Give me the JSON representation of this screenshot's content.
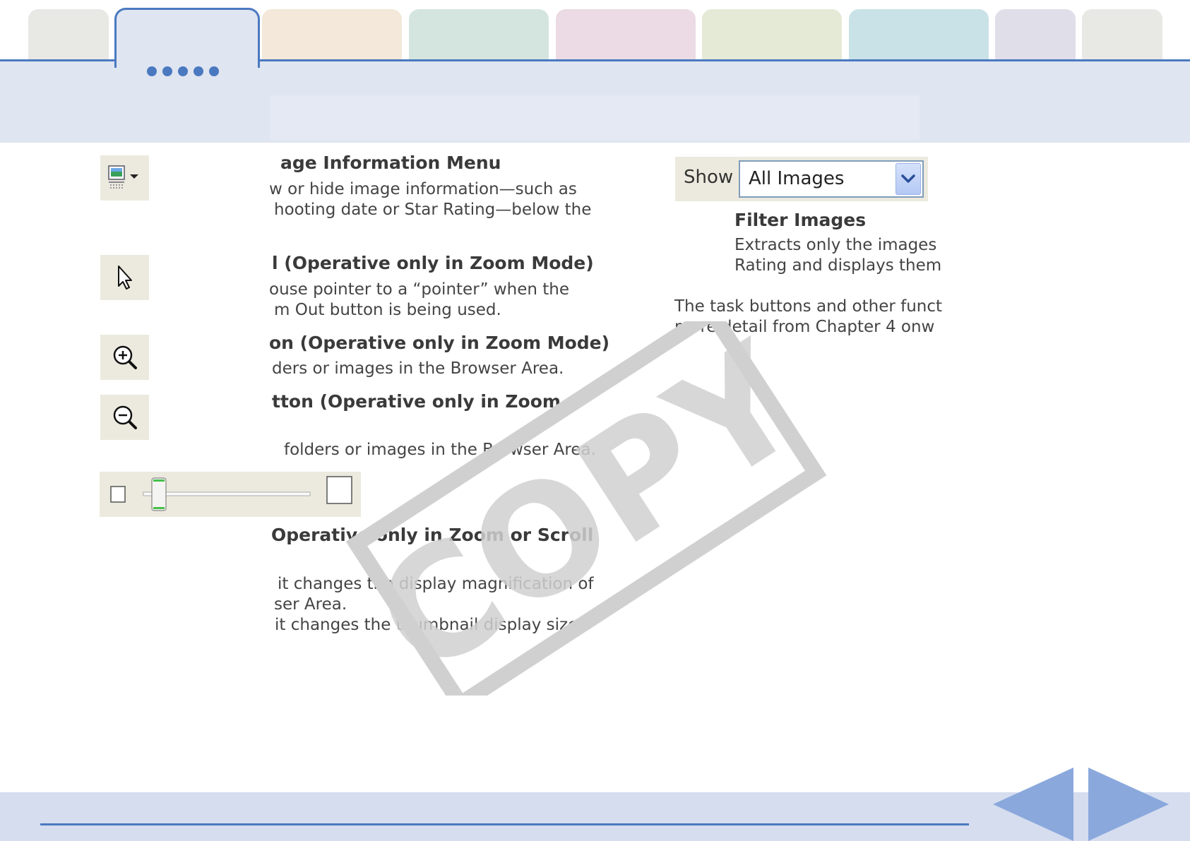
{
  "tabs": [
    {
      "id": "tab-1",
      "color": "#e8e8e4"
    },
    {
      "id": "tab-2",
      "color": "#dfe5f1",
      "active": true
    },
    {
      "id": "tab-3",
      "color": "#f3e8d9"
    },
    {
      "id": "tab-4",
      "color": "#d4e5df"
    },
    {
      "id": "tab-5",
      "color": "#ecdbe4"
    },
    {
      "id": "tab-6",
      "color": "#e4ead6"
    },
    {
      "id": "tab-7",
      "color": "#c9e2e8"
    },
    {
      "id": "tab-8",
      "color": "#e0dee9"
    },
    {
      "id": "tab-9",
      "color": "#e8e8e4"
    }
  ],
  "sections": {
    "image_info": {
      "heading": "age Information Menu",
      "line1": "w or hide image information—such as",
      "line2": "hooting date or Star Rating—below the"
    },
    "select_tool": {
      "heading": "l (Operative only in Zoom Mode)",
      "line1": "ouse pointer to a “pointer” when the",
      "line2": "m Out button is being used."
    },
    "zoom_in": {
      "heading": "on (Operative only in Zoom Mode)",
      "line1": "ders or images in the Browser Area."
    },
    "zoom_out": {
      "heading": "tton (Operative only in Zoom",
      "line1": "folders or images in the Browser Area."
    },
    "slider": {
      "heading": "Operative only in Zoom or Scroll",
      "line1": "it changes the display magnification of",
      "line2": "ser Area.",
      "line3": "it changes the thumbnail display size."
    },
    "filter": {
      "show_label": "Show",
      "select_value": "All Images",
      "heading": "Filter Images",
      "line1": "Extracts only the images",
      "line2": "Rating and displays them"
    },
    "note": {
      "line1": "The task buttons and other funct",
      "line2": "more detail from Chapter 4 onw"
    }
  },
  "watermark": {
    "text": "COPY"
  },
  "icons": {
    "image_info": "image-info-icon",
    "pointer": "pointer-arrow-icon",
    "zoom_in": "zoom-in-icon",
    "zoom_out": "zoom-out-icon",
    "prev": "previous-page-icon",
    "next": "next-page-icon"
  },
  "colors": {
    "accent": "#4a79c0",
    "nav_arrow": "#8aa8dc",
    "footer": "#d5ddef"
  }
}
